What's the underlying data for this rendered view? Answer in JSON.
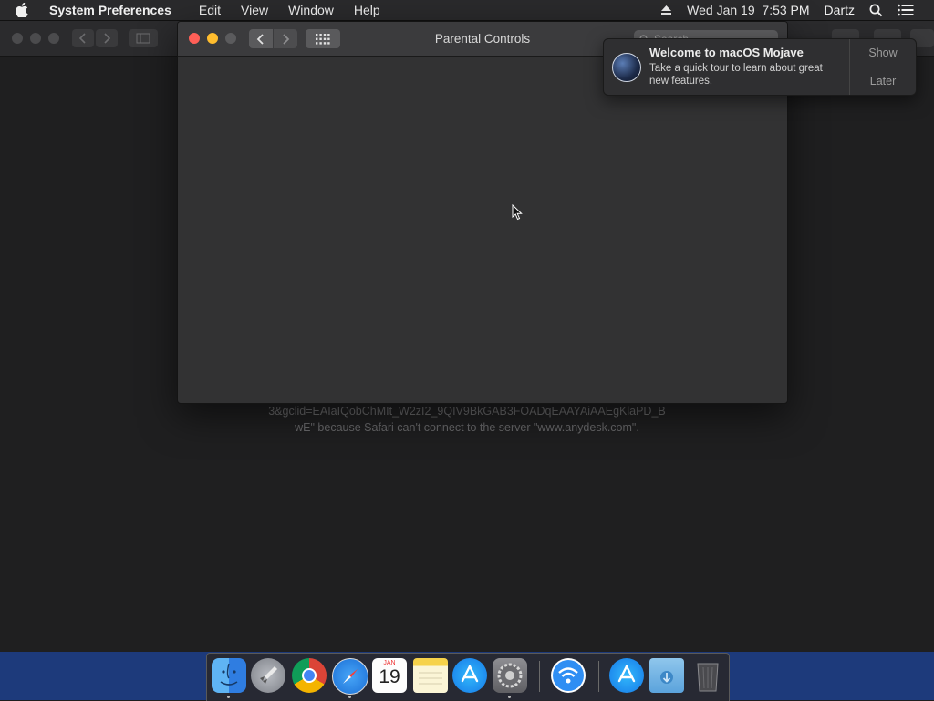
{
  "menubar": {
    "app_name": "System Preferences",
    "items": [
      "Edit",
      "View",
      "Window",
      "Help"
    ],
    "datetime": "Wed Jan 19  7:53 PM",
    "user": "Dartz"
  },
  "background_window": {
    "error_line1": "3&gclid=EAIaIQobChMIt_W2zI2_9QIV9BkGAB3FOADqEAAYAiAAEgKlaPD_B",
    "error_line2": "wE\" because Safari can't connect to the server \"www.anydesk.com\"."
  },
  "pref_window": {
    "title": "Parental Controls",
    "search_placeholder": "Search"
  },
  "notification": {
    "title": "Welcome to macOS Mojave",
    "body": "Take a quick tour to learn about great new features.",
    "show_label": "Show",
    "later_label": "Later"
  },
  "dock": {
    "calendar_month": "JAN",
    "calendar_day": "19",
    "apps": [
      "finder",
      "launchpad",
      "chrome",
      "safari",
      "calendar",
      "notes",
      "app-store",
      "system-preferences",
      "wifi-diagnostics",
      "app-store-downloads",
      "downloads-folder",
      "trash"
    ]
  },
  "colors": {
    "close": "#ff5f57",
    "minimize": "#ffbd2e",
    "desktop": "#1d3a7b"
  }
}
